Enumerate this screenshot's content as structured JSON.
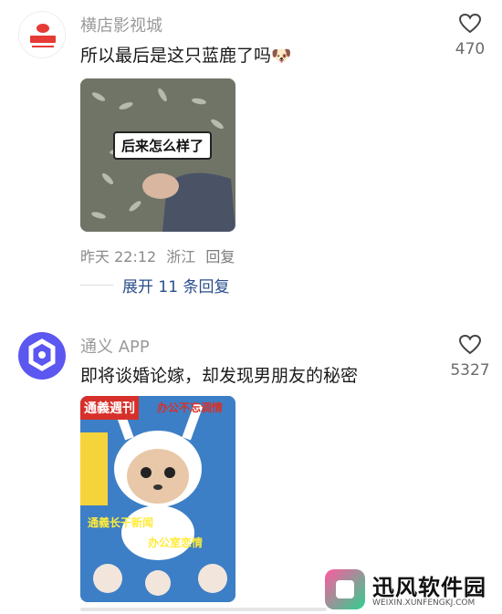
{
  "comments": [
    {
      "author": "横店影视城",
      "avatar_icon": "hengdian-logo",
      "text": "所以最后是这只蓝鹿了吗",
      "emoji": "🐶",
      "likes": "470",
      "media_caption": "后来怎么样了",
      "time": "昨天 22:12",
      "location": "浙江",
      "reply": "回复",
      "expand": "展开 11 条回复"
    },
    {
      "author": "通义 APP",
      "avatar_icon": "tongyi-logo",
      "text": "即将谈婚论嫁，却发现男朋友的秘密",
      "likes": "5327",
      "media_badge": "通義週刊",
      "media_badge_2": "办公不忘调情",
      "media_banner_1": "通義长干新闻",
      "media_banner_2": "办公室恋情"
    }
  ],
  "watermark": {
    "title": "迅风软件园",
    "subtitle": "WEIXIN.XUNFENGKJ.COM"
  },
  "colors": {
    "link": "#2a4e8c",
    "muted": "#9a9a9a",
    "tongyi_purple": "#5b57f0",
    "hengdian_red": "#d7302a"
  }
}
